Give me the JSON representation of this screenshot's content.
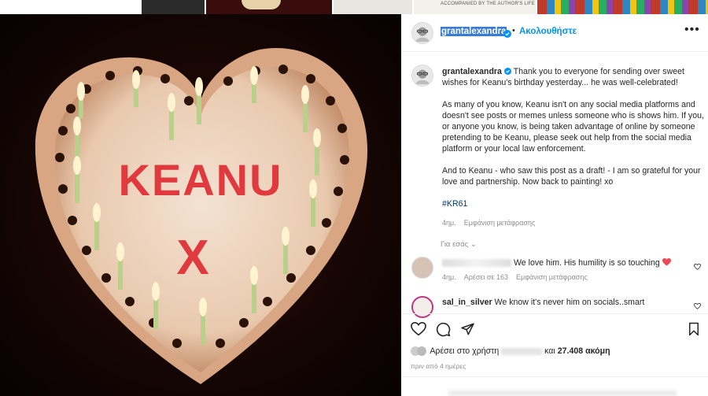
{
  "post_author": {
    "username": "grantalexandra",
    "follow_label": "Ακολουθήστε",
    "separator": "•",
    "more_icon": "more-horizontal-icon"
  },
  "image": {
    "description_text": "KEANU",
    "x_text": "X"
  },
  "background_strip": {
    "book_caption": "ACCOMPANIED BY THE AUTHOR'S LIFE"
  },
  "caption": {
    "username": "grantalexandra",
    "paragraph1": " Thank you to everyone for sending over sweet wishes for Keanu's birthday yesterday... he was well-celebrated!",
    "paragraph2": "As many of you know, Keanu isn't on any social media platforms and doesn't see posts or memes unless someone who is shows him. If you, or anyone you know, is being taken advantage of online by someone pretending to be Keanu, please seek out help from the social media platform or your local law enforcement.",
    "paragraph3": "And to Keanu - who saw this post as a draft! - I am so grateful for your love and partnership. Now back to painting! xo",
    "hashtag": "#KR61",
    "age": "4ημ.",
    "translate": "Εμφάνιση μετάφρασης"
  },
  "for_you_label": "Για εσάς",
  "comments": [
    {
      "username_visible": "",
      "text": " We love him. His humility is so touching ",
      "age": "4ημ.",
      "likes": "Αρέσει σε 163",
      "translate": "Εμφάνιση μετάφρασης"
    },
    {
      "username_visible": "sal_in_silver",
      "text": " We know it's never him on socials..smart",
      "age": "",
      "likes": "",
      "translate": ""
    }
  ],
  "likes_line": {
    "prefix": "Αρέσει στο χρήστη ",
    "middle": " και ",
    "count": "27.408 ακόμη"
  },
  "timestamp": "πριν από 4 ημέρες",
  "colors": {
    "accent": "#0095f6",
    "verified": "#0095f6",
    "heart": "#ed4956",
    "selection": "#3a7bd5"
  }
}
